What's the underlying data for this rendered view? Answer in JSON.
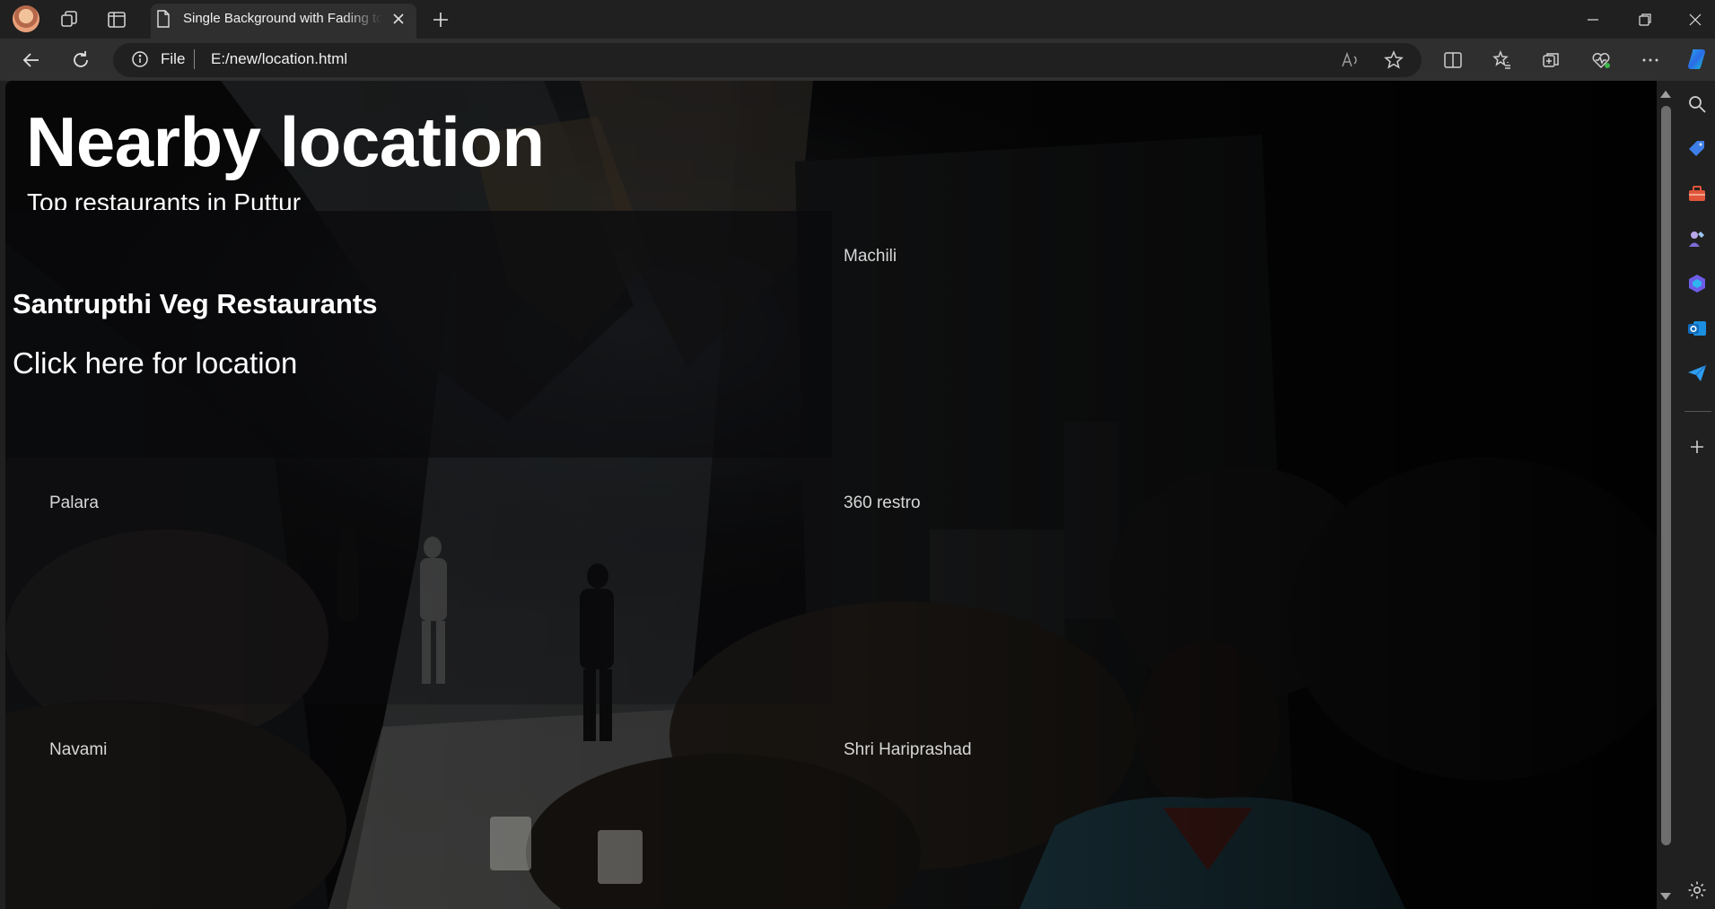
{
  "browser": {
    "tab": {
      "title": "Single Background with Fading to"
    },
    "address_bar": {
      "scheme_label": "File",
      "url": "E:/new/location.html"
    },
    "icons": {
      "profile": "profile-avatar-icon",
      "workspaces": "workspaces-icon",
      "vertical_tabs": "vertical-tabs-icon",
      "page": "page-icon",
      "close_tab": "close-icon",
      "new_tab": "plus-icon",
      "back": "back-arrow-icon",
      "refresh": "refresh-icon",
      "site_info": "info-icon",
      "read_aloud": "read-aloud-icon",
      "favorite": "star-icon",
      "split_screen": "split-screen-icon",
      "favorites": "favorites-icon",
      "collections": "collections-icon",
      "performance": "heartbeat-icon",
      "more": "more-icon",
      "copilot": "copilot-icon"
    },
    "sidebar_icons": [
      "search-icon",
      "shopping-tag-icon",
      "tools-icon",
      "games-icon",
      "microsoft-365-icon",
      "outlook-icon",
      "send-icon",
      "plus-icon",
      "settings-icon"
    ]
  },
  "page": {
    "title": "Nearby location",
    "subtitle": "Top restaurants in Puttur",
    "featured": {
      "name": "Santrupthi Veg Restaurants",
      "link_text": "Click here for location"
    },
    "restaurants": [
      {
        "name": "Machili"
      },
      {
        "name": "Palara"
      },
      {
        "name": "360 restro"
      },
      {
        "name": "Navami"
      },
      {
        "name": "Shri Hariprashad"
      }
    ]
  },
  "colors": {
    "chrome_dark": "#202020",
    "chrome_toolbar": "#2f2f2f",
    "page_text": "#ffffff",
    "page_muted_text": "#d7d7d7"
  }
}
